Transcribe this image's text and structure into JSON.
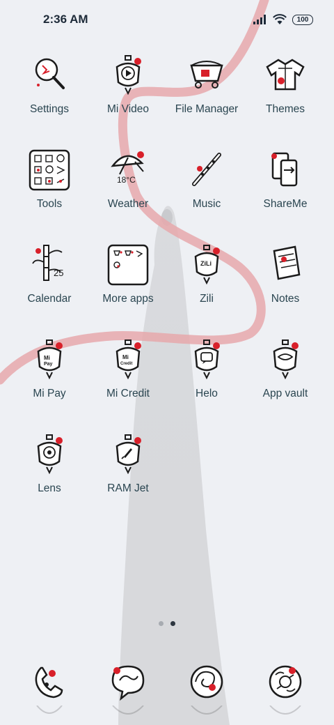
{
  "status_bar": {
    "time": "2:36 AM",
    "battery": "100"
  },
  "apps": [
    {
      "label": "Settings",
      "icon": "magnifier-settings-icon"
    },
    {
      "label": "Mi Video",
      "icon": "lantern-play-icon"
    },
    {
      "label": "File Manager",
      "icon": "cart-file-icon"
    },
    {
      "label": "Themes",
      "icon": "robe-themes-icon"
    },
    {
      "label": "Tools",
      "icon": "tools-folder-icon"
    },
    {
      "label": "Weather",
      "icon": "umbrella-weather-icon",
      "badge": "18°C"
    },
    {
      "label": "Music",
      "icon": "flute-music-icon"
    },
    {
      "label": "ShareMe",
      "icon": "shareme-icon"
    },
    {
      "label": "Calendar",
      "icon": "bamboo-calendar-icon",
      "badge": "25"
    },
    {
      "label": "More apps",
      "icon": "more-apps-folder-icon"
    },
    {
      "label": "Zili",
      "icon": "lantern-zili-icon"
    },
    {
      "label": "Notes",
      "icon": "scroll-notes-icon"
    },
    {
      "label": "Mi Pay",
      "icon": "lantern-mipay-icon"
    },
    {
      "label": "Mi Credit",
      "icon": "lantern-micredit-icon"
    },
    {
      "label": "Helo",
      "icon": "lantern-helo-icon"
    },
    {
      "label": "App vault",
      "icon": "lantern-appvault-icon"
    },
    {
      "label": "Lens",
      "icon": "lantern-lens-icon"
    },
    {
      "label": "RAM Jet",
      "icon": "lantern-ramjet-icon"
    }
  ],
  "dock": [
    {
      "icon": "dock-phone-icon"
    },
    {
      "icon": "dock-messages-icon"
    },
    {
      "icon": "dock-browser-icon"
    },
    {
      "icon": "dock-camera-icon"
    }
  ],
  "page_indicator": {
    "pages": 2,
    "current": 2
  },
  "colors": {
    "accent_red": "#d8202a",
    "ink": "#1b1b1b",
    "label": "#2a4550",
    "ribbon": "#e6a8ab"
  }
}
